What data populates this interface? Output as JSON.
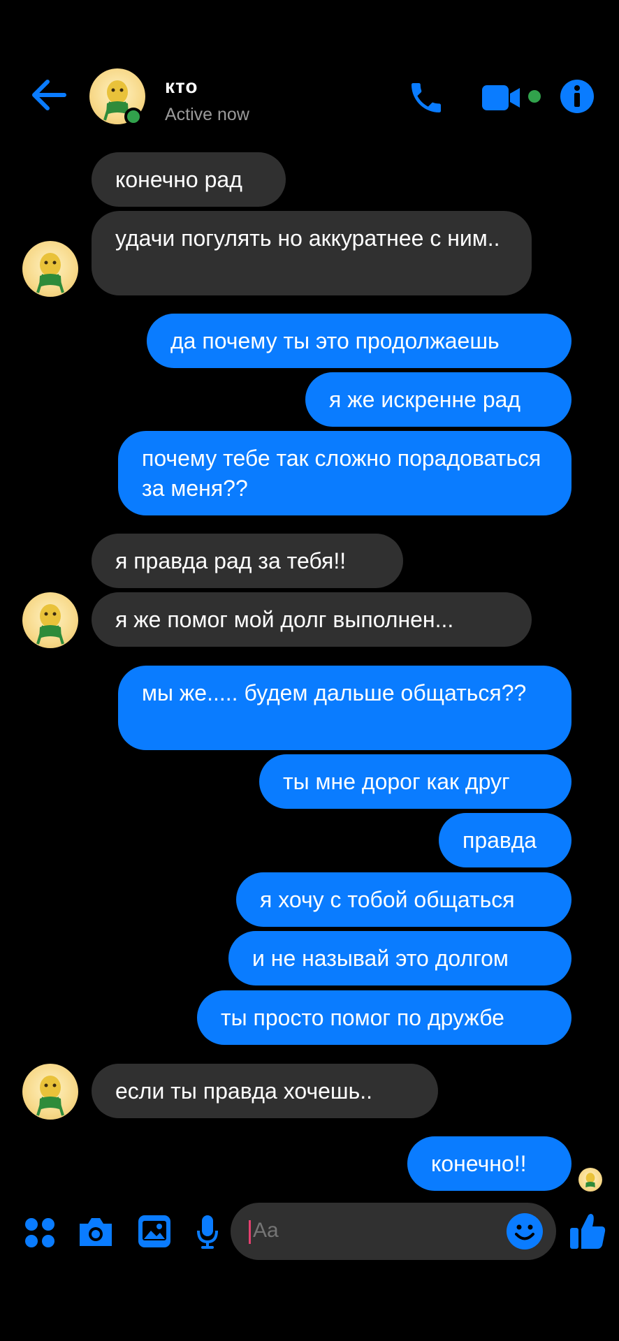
{
  "header": {
    "contact_name": "кто",
    "status": "Active now"
  },
  "messages": [
    {
      "dir": "in",
      "text": "конечно рад"
    },
    {
      "dir": "in",
      "text": "удачи погулять но аккуратнее с ним.."
    },
    {
      "dir": "out",
      "text": "да почему ты это продолжаешь"
    },
    {
      "dir": "out",
      "text": "я же искренне рад"
    },
    {
      "dir": "out",
      "text": "почему тебе так сложно порадоваться за меня??"
    },
    {
      "dir": "in",
      "text": "я правда рад за тебя!!"
    },
    {
      "dir": "in",
      "text": "я же помог мой долг выполнен..."
    },
    {
      "dir": "out",
      "text": "мы же..... будем дальше общаться??"
    },
    {
      "dir": "out",
      "text": "ты мне дорог как друг"
    },
    {
      "dir": "out",
      "text": "правда"
    },
    {
      "dir": "out",
      "text": "я хочу с тобой общаться"
    },
    {
      "dir": "out",
      "text": "и не называй это долгом"
    },
    {
      "dir": "out",
      "text": "ты просто помог по дружбе"
    },
    {
      "dir": "in",
      "text": "если ты правда хочешь.."
    },
    {
      "dir": "out",
      "text": "конечно!!"
    }
  ],
  "composer": {
    "placeholder": "Aa"
  },
  "colors": {
    "accent": "#0a7cff",
    "incoming_bubble": "#303030",
    "online": "#31a24c",
    "background": "#000000"
  },
  "icons": [
    "back-arrow-icon",
    "phone-icon",
    "video-camera-icon",
    "info-icon",
    "apps-grid-icon",
    "camera-icon",
    "gallery-icon",
    "microphone-icon",
    "emoji-icon",
    "thumbs-up-icon"
  ]
}
